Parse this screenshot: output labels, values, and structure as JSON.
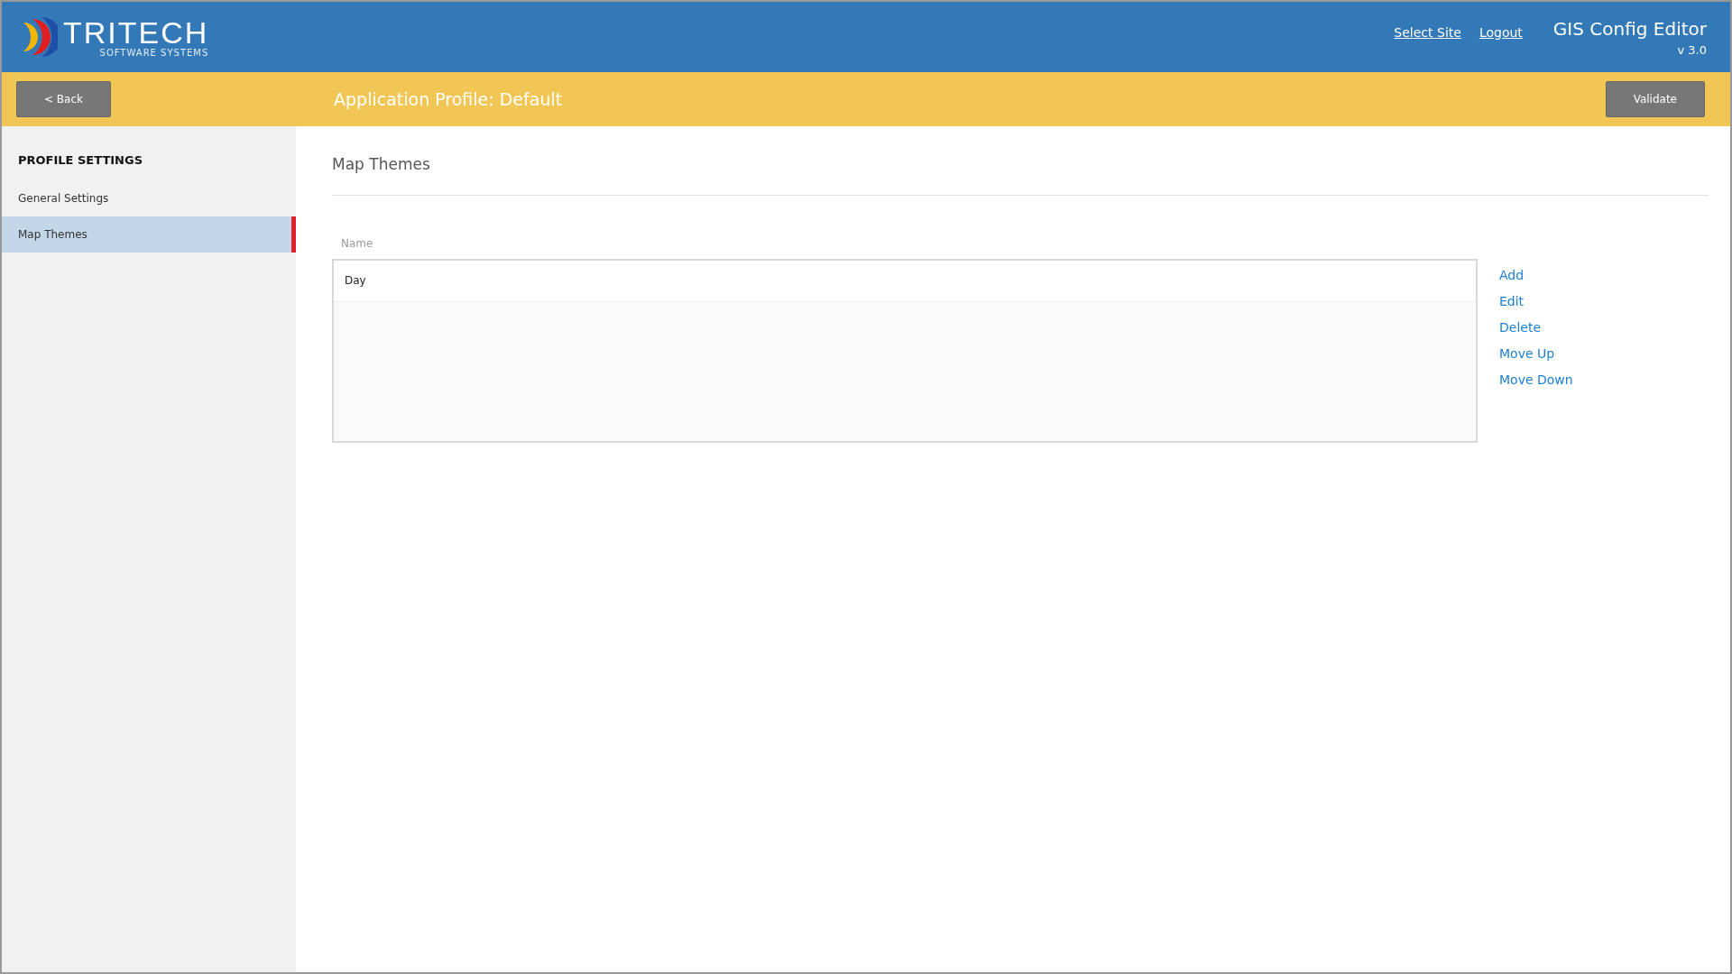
{
  "header": {
    "logo": {
      "name": "TRITECH",
      "tagline": "SOFTWARE SYSTEMS"
    },
    "links": [
      "Select Site",
      "Logout"
    ],
    "app_title": "GIS Config Editor",
    "version": "v 3.0"
  },
  "toolbar": {
    "back_button": "< Back",
    "title": "Application Profile: Default",
    "validate_button": "Validate"
  },
  "sidebar": {
    "heading": "PROFILE SETTINGS",
    "items": [
      {
        "label": "General Settings",
        "selected": false
      },
      {
        "label": "Map Themes",
        "selected": true
      }
    ]
  },
  "content": {
    "heading": "Map Themes",
    "list": {
      "column": "Name",
      "rows": [
        "Day"
      ]
    },
    "actions": [
      "Add",
      "Edit",
      "Delete",
      "Move Up",
      "Move Down"
    ]
  }
}
